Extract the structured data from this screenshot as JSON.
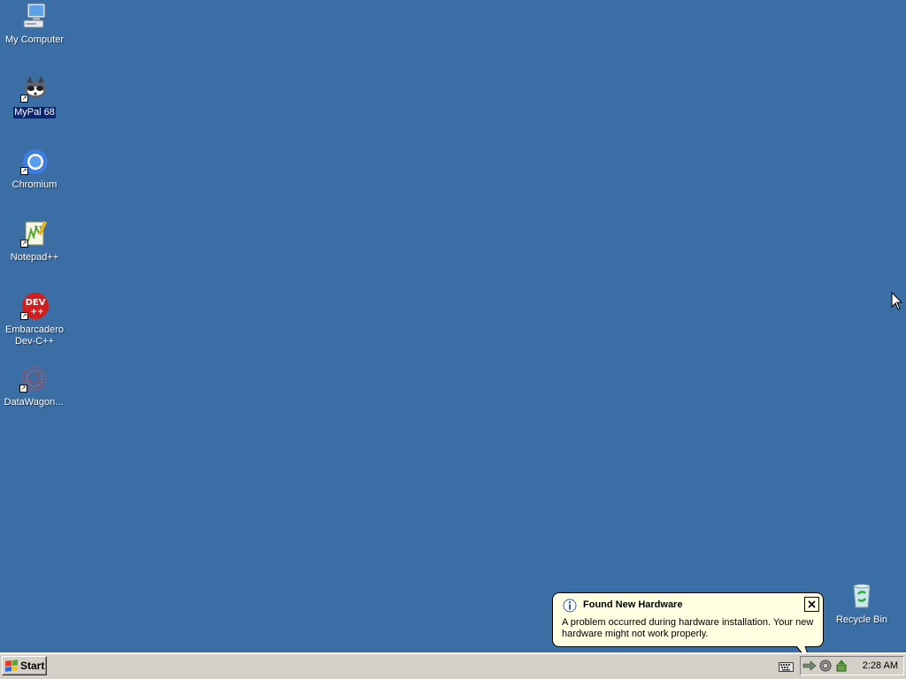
{
  "desktop": {
    "background_color": "#3a6ea5",
    "icons": [
      {
        "label": "My Computer",
        "icon": "computer-icon"
      },
      {
        "label": "MyPal 68",
        "icon": "mypal-icon",
        "selected": true
      },
      {
        "label": "Chromium",
        "icon": "chromium-icon"
      },
      {
        "label": "Notepad++",
        "icon": "notepadpp-icon"
      },
      {
        "label": "Embarcadero Dev-C++",
        "icon": "devcpp-icon",
        "badge": "DEV\n++"
      },
      {
        "label": "DataWagon...",
        "icon": "datawagon-icon"
      },
      {
        "label": "Recycle Bin",
        "icon": "recycle-bin-icon"
      }
    ]
  },
  "balloon": {
    "title": "Found New Hardware",
    "message": "A problem occurred during hardware installation. Your new hardware might not work properly.",
    "icon": "info-icon"
  },
  "taskbar": {
    "start_label": "Start",
    "clock": "2:28 AM",
    "tray_icons": [
      "network-icon",
      "hardware-warning-icon",
      "safely-remove-icon"
    ],
    "input_icon": "keyboard-icon"
  }
}
